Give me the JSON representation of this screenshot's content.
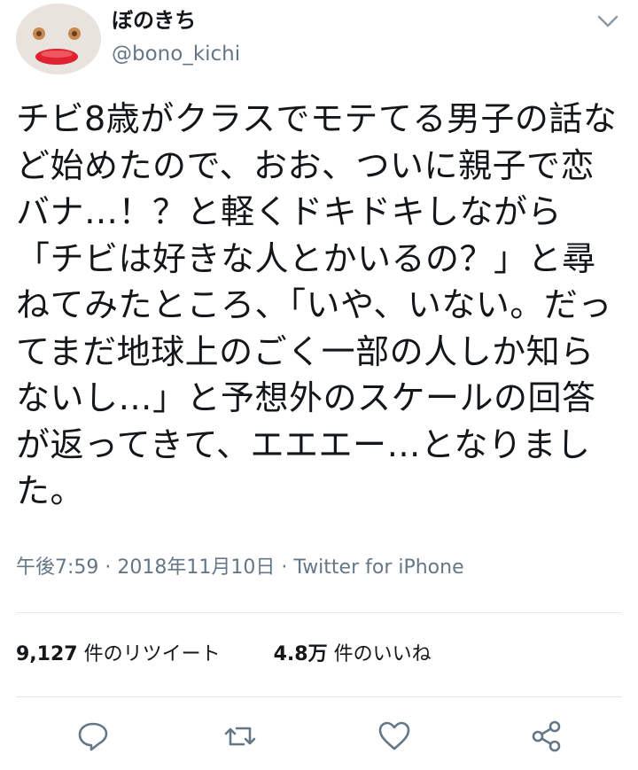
{
  "user": {
    "display_name": "ぼのきち",
    "handle": "@bono_kichi",
    "avatar_icon": "avatar-image"
  },
  "tweet": {
    "text": "チビ8歳がクラスでモテてる男子の話など始めたので、おお、ついに親子で恋バナ…！？と軽くドキドキしながら「チビは好きな人とかいるの？」と尋ねてみたところ、「いや、いない。だってまだ地球上のごく一部の人しか知らないし…」と予想外のスケールの回答が返ってきて、エエエー…となりました。",
    "time": "午後7:59",
    "separator": "·",
    "date": "2018年11月10日",
    "source": "Twitter for iPhone"
  },
  "stats": {
    "retweets_count": "9,127",
    "retweets_label": " 件のリツイート",
    "likes_count": "4.8万",
    "likes_label": " 件のいいね"
  },
  "actions": {
    "reply_icon": "reply-icon",
    "retweet_icon": "retweet-icon",
    "like_icon": "heart-icon",
    "share_icon": "share-icon"
  },
  "colors": {
    "text": "#14171a",
    "secondary": "#657786",
    "divider": "#e1e8ed",
    "icon": "#657786"
  }
}
